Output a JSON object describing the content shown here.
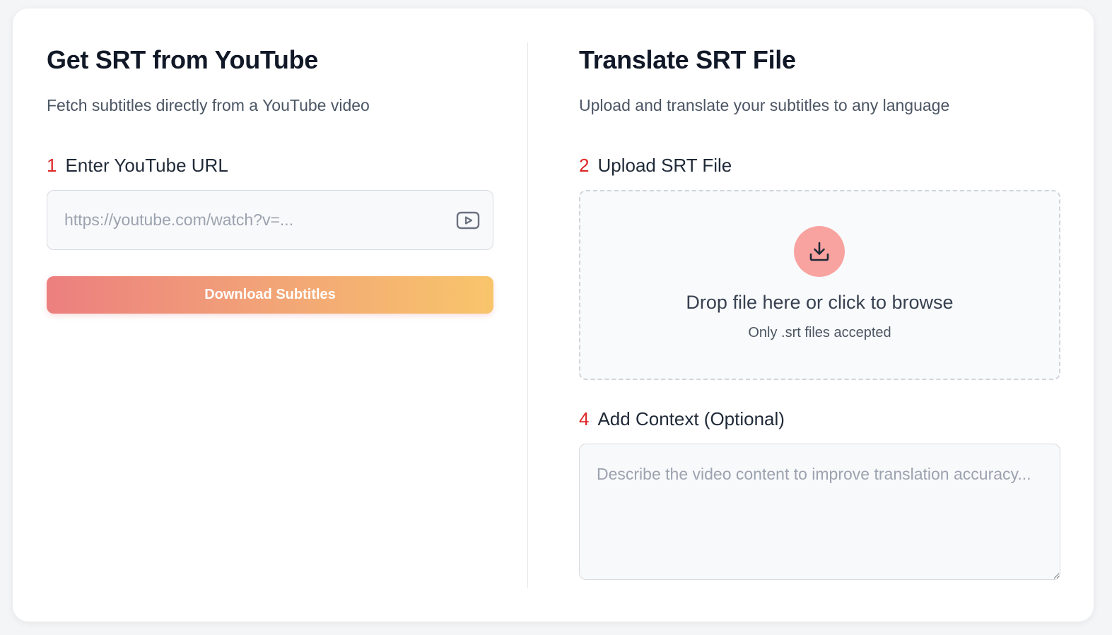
{
  "youtube_panel": {
    "title": "Get SRT from YouTube",
    "subtitle": "Fetch subtitles directly from a YouTube video",
    "step_number": "1",
    "step_label": "Enter YouTube URL",
    "url_placeholder": "https://youtube.com/watch?v=...",
    "url_value": "",
    "url_icon": "youtube-play-icon",
    "download_button_label": "Download Subtitles"
  },
  "translate_panel": {
    "title": "Translate SRT File",
    "subtitle": "Upload and translate your subtitles to any language",
    "upload_step_number": "2",
    "upload_step_label": "Upload SRT File",
    "dropzone_icon": "download-arrow-icon",
    "dropzone_text": "Drop file here or click to browse",
    "dropzone_hint": "Only .srt files accepted",
    "context_step_number": "4",
    "context_step_label": "Add Context (Optional)",
    "context_placeholder": "Describe the video content to improve translation accuracy...",
    "context_value": ""
  },
  "colors": {
    "step_number": "#dc2626",
    "button_gradient_start": "#ec7f7f",
    "button_gradient_end": "#f8c56b",
    "upload_circle": "#f8a3a0"
  }
}
